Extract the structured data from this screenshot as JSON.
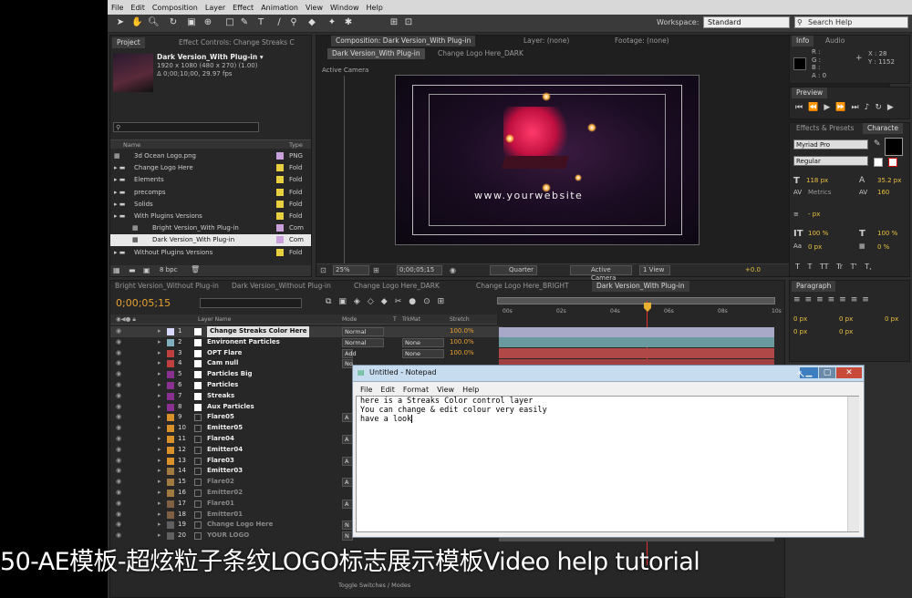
{
  "menu": [
    "File",
    "Edit",
    "Composition",
    "Layer",
    "Effect",
    "Animation",
    "View",
    "Window",
    "Help"
  ],
  "workspace": {
    "label": "Workspace:",
    "value": "Standard"
  },
  "search_help": "Search Help",
  "project": {
    "tabs": [
      "Project",
      "Effect Controls: Change Streaks C"
    ],
    "comp_name": "Dark Version_With Plug-in ▾",
    "comp_info": [
      "1920 x 1080  (480 x 270) (1.00)",
      "Δ 0;00;10;00, 29.97 fps"
    ],
    "col_name": "Name",
    "col_type": "Type",
    "items": [
      {
        "name": "3d Ocean Logo.png",
        "type": "PNG",
        "color": "#c9a0dc"
      },
      {
        "name": "Change Logo Here",
        "type": "Fold",
        "color": "#e8d040"
      },
      {
        "name": "Elements",
        "type": "Fold",
        "color": "#e8d040"
      },
      {
        "name": "precomps",
        "type": "Fold",
        "color": "#e8d040"
      },
      {
        "name": "Solids",
        "type": "Fold",
        "color": "#e8d040"
      },
      {
        "name": "With Plugins Versions",
        "type": "Fold",
        "color": "#e8d040"
      },
      {
        "name": "Bright Version_With Plug-in",
        "type": "Com",
        "color": "#c9a0dc"
      },
      {
        "name": "Dark Version_With Plug-in",
        "type": "Com",
        "color": "#c9a0dc"
      },
      {
        "name": "Without Plugins Versions",
        "type": "Fold",
        "color": "#e8d040"
      }
    ],
    "bpc": "8 bpc"
  },
  "composition": {
    "tabs": [
      "Composition: Dark Version_With Plug-in",
      "Layer: (none)",
      "Footage: (none)"
    ],
    "breadcrumbs": [
      "Dark Version_With Plug-in",
      "Change Logo Here_DARK"
    ],
    "active_camera": "Active Camera",
    "website": "www.yourwebsite",
    "zoom": "25%",
    "timecode": "0;00;05;15",
    "quality": "Quarter",
    "view": "Active Camera",
    "views": "1 View",
    "exposure": "+0.0"
  },
  "info": {
    "tabs": [
      "Info",
      "Audio"
    ],
    "rgba": [
      "R :",
      "G :",
      "B :",
      "A : 0"
    ],
    "x": "X : 28",
    "y": "Y : 1152"
  },
  "preview": {
    "tab": "Preview"
  },
  "effects": {
    "tabs": [
      "Effects & Presets",
      "Characte"
    ],
    "font": "Myriad Pro",
    "style": "Regular",
    "size": "118 px",
    "lead": "35.2 px",
    "metrics": "Metrics",
    "track": "160",
    "stroke": "- px",
    "vscale": "100 %",
    "hscale": "100 %",
    "baseline": "0 px",
    "tsume": "0 %",
    "typebtns": [
      "T",
      "T",
      "TT",
      "Tr",
      "T'",
      "T,"
    ]
  },
  "paragraph": {
    "tab": "Paragraph",
    "values": [
      "0 px",
      "0 px",
      "0 px",
      "0 px",
      "0 px"
    ]
  },
  "timeline": {
    "tabs": [
      "Bright Version_Without Plug-in",
      "Dark Version_Without Plug-in",
      "Change Logo Here_DARK",
      "Change Logo Here_BRIGHT",
      "Dark Version_With Plug-in"
    ],
    "timecode": "0;00;05;15",
    "col_layer": "Layer Name",
    "col_mode": "Mode",
    "col_t": "T",
    "col_trkmat": "TrkMat",
    "col_stretch": "Stretch",
    "ticks": [
      "00s",
      "02s",
      "04s",
      "06s",
      "08s",
      "10s"
    ],
    "footer": "Toggle Switches / Modes",
    "layers": [
      {
        "n": "1",
        "name": "Change Streaks Color Here",
        "mode": "Normal",
        "trk": "",
        "stretch": "100.0%",
        "color": "#d8d8ff",
        "bar": "#a8a8c8"
      },
      {
        "n": "2",
        "name": "Environent Particles",
        "mode": "Normal",
        "trk": "None",
        "stretch": "100.0%",
        "color": "#7fb0c0",
        "bar": "#6a9aa0"
      },
      {
        "n": "3",
        "name": "OPT Flare",
        "mode": "Add",
        "trk": "None",
        "stretch": "100.0%",
        "color": "#c04040",
        "bar": "#b04848"
      },
      {
        "n": "4",
        "name": "Cam null",
        "mode": "No",
        "trk": "",
        "stretch": "",
        "color": "#c04040",
        "bar": "#a04040"
      },
      {
        "n": "5",
        "name": "Particles Big",
        "mode": "",
        "trk": "",
        "stretch": "",
        "color": "#8a3090",
        "bar": "#8a3090"
      },
      {
        "n": "6",
        "name": "Particles",
        "mode": "",
        "trk": "",
        "stretch": "",
        "color": "#8a3090",
        "bar": "#8a3090"
      },
      {
        "n": "7",
        "name": "Streaks",
        "mode": "",
        "trk": "",
        "stretch": "",
        "color": "#8a3090",
        "bar": "#8a3090"
      },
      {
        "n": "8",
        "name": "Aux Particles",
        "mode": "",
        "trk": "",
        "stretch": "",
        "color": "#8a3090",
        "bar": "#8a3090"
      },
      {
        "n": "9",
        "name": "Flare05",
        "mode": "A",
        "trk": "",
        "stretch": "",
        "color": "#d8902a",
        "bar": "#b07a30"
      },
      {
        "n": "10",
        "name": "Emitter05",
        "mode": "",
        "trk": "",
        "stretch": "",
        "color": "#d8902a",
        "bar": "#b07a30"
      },
      {
        "n": "11",
        "name": "Flare04",
        "mode": "A",
        "trk": "",
        "stretch": "",
        "color": "#d8902a",
        "bar": "#b07a30"
      },
      {
        "n": "12",
        "name": "Emitter04",
        "mode": "",
        "trk": "",
        "stretch": "",
        "color": "#d8902a",
        "bar": "#b07a30"
      },
      {
        "n": "13",
        "name": "Flare03",
        "mode": "A",
        "trk": "",
        "stretch": "",
        "color": "#d8902a",
        "bar": "#b07a30"
      },
      {
        "n": "14",
        "name": "Emitter03",
        "mode": "",
        "trk": "",
        "stretch": "",
        "color": "#a07a40",
        "bar": "#8a6a40"
      },
      {
        "n": "15",
        "name": "Flare02",
        "mode": "A",
        "trk": "",
        "stretch": "",
        "color": "#a07a40",
        "bar": "#8a6a40"
      },
      {
        "n": "16",
        "name": "Emitter02",
        "mode": "",
        "trk": "",
        "stretch": "",
        "color": "#a07a40",
        "bar": "#8a6a40"
      },
      {
        "n": "17",
        "name": "Flare01",
        "mode": "A",
        "trk": "",
        "stretch": "",
        "color": "#806040",
        "bar": "#6a5a40"
      },
      {
        "n": "18",
        "name": "Emitter01",
        "mode": "",
        "trk": "",
        "stretch": "",
        "color": "#806040",
        "bar": "#6a5a40"
      },
      {
        "n": "19",
        "name": "Change Logo Here",
        "mode": "N",
        "trk": "",
        "stretch": "",
        "color": "#606060",
        "bar": "#505050"
      },
      {
        "n": "20",
        "name": "YOUR LOGO",
        "mode": "N",
        "trk": "",
        "stretch": "",
        "color": "#606060",
        "bar": "#505050"
      }
    ]
  },
  "notepad": {
    "title": "Untitled - Notepad",
    "menu": [
      "File",
      "Edit",
      "Format",
      "View",
      "Help"
    ],
    "lines": [
      "here is a Streaks Color control layer",
      "You can change & edit colour very easily",
      "have a look"
    ]
  },
  "caption": "50-AE模板-超炫粒子条纹LOGO标志展示模板Video help tutorial"
}
